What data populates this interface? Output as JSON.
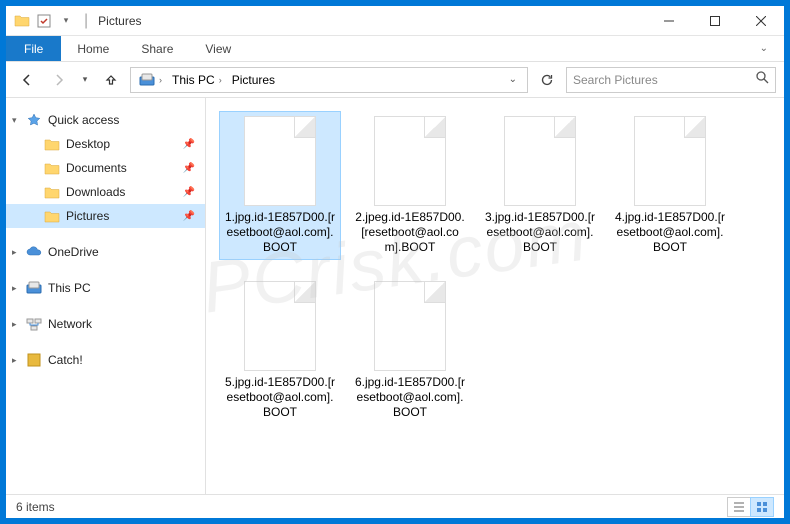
{
  "window": {
    "title": "Pictures",
    "item_count_label": "6 items"
  },
  "ribbon": {
    "file": "File",
    "tabs": [
      "Home",
      "Share",
      "View"
    ]
  },
  "breadcrumb": {
    "segments": [
      "This PC",
      "Pictures"
    ]
  },
  "search": {
    "placeholder": "Search Pictures"
  },
  "sidebar": {
    "quick_access": "Quick access",
    "quick_items": [
      {
        "label": "Desktop",
        "pinned": true
      },
      {
        "label": "Documents",
        "pinned": true
      },
      {
        "label": "Downloads",
        "pinned": true
      },
      {
        "label": "Pictures",
        "pinned": true,
        "selected": true
      }
    ],
    "roots": [
      {
        "label": "OneDrive"
      },
      {
        "label": "This PC"
      },
      {
        "label": "Network"
      },
      {
        "label": "Catch!"
      }
    ]
  },
  "files": [
    {
      "name": "1.jpg.id-1E857D00.[resetboot@aol.com].BOOT",
      "selected": true
    },
    {
      "name": "2.jpeg.id-1E857D00.[resetboot@aol.com].BOOT"
    },
    {
      "name": "3.jpg.id-1E857D00.[resetboot@aol.com].BOOT"
    },
    {
      "name": "4.jpg.id-1E857D00.[resetboot@aol.com].BOOT"
    },
    {
      "name": "5.jpg.id-1E857D00.[resetboot@aol.com].BOOT"
    },
    {
      "name": "6.jpg.id-1E857D00.[resetboot@aol.com].BOOT"
    }
  ],
  "watermark": "PCrisk.com",
  "colors": {
    "accent": "#0078d7",
    "selection": "#cde8ff"
  }
}
